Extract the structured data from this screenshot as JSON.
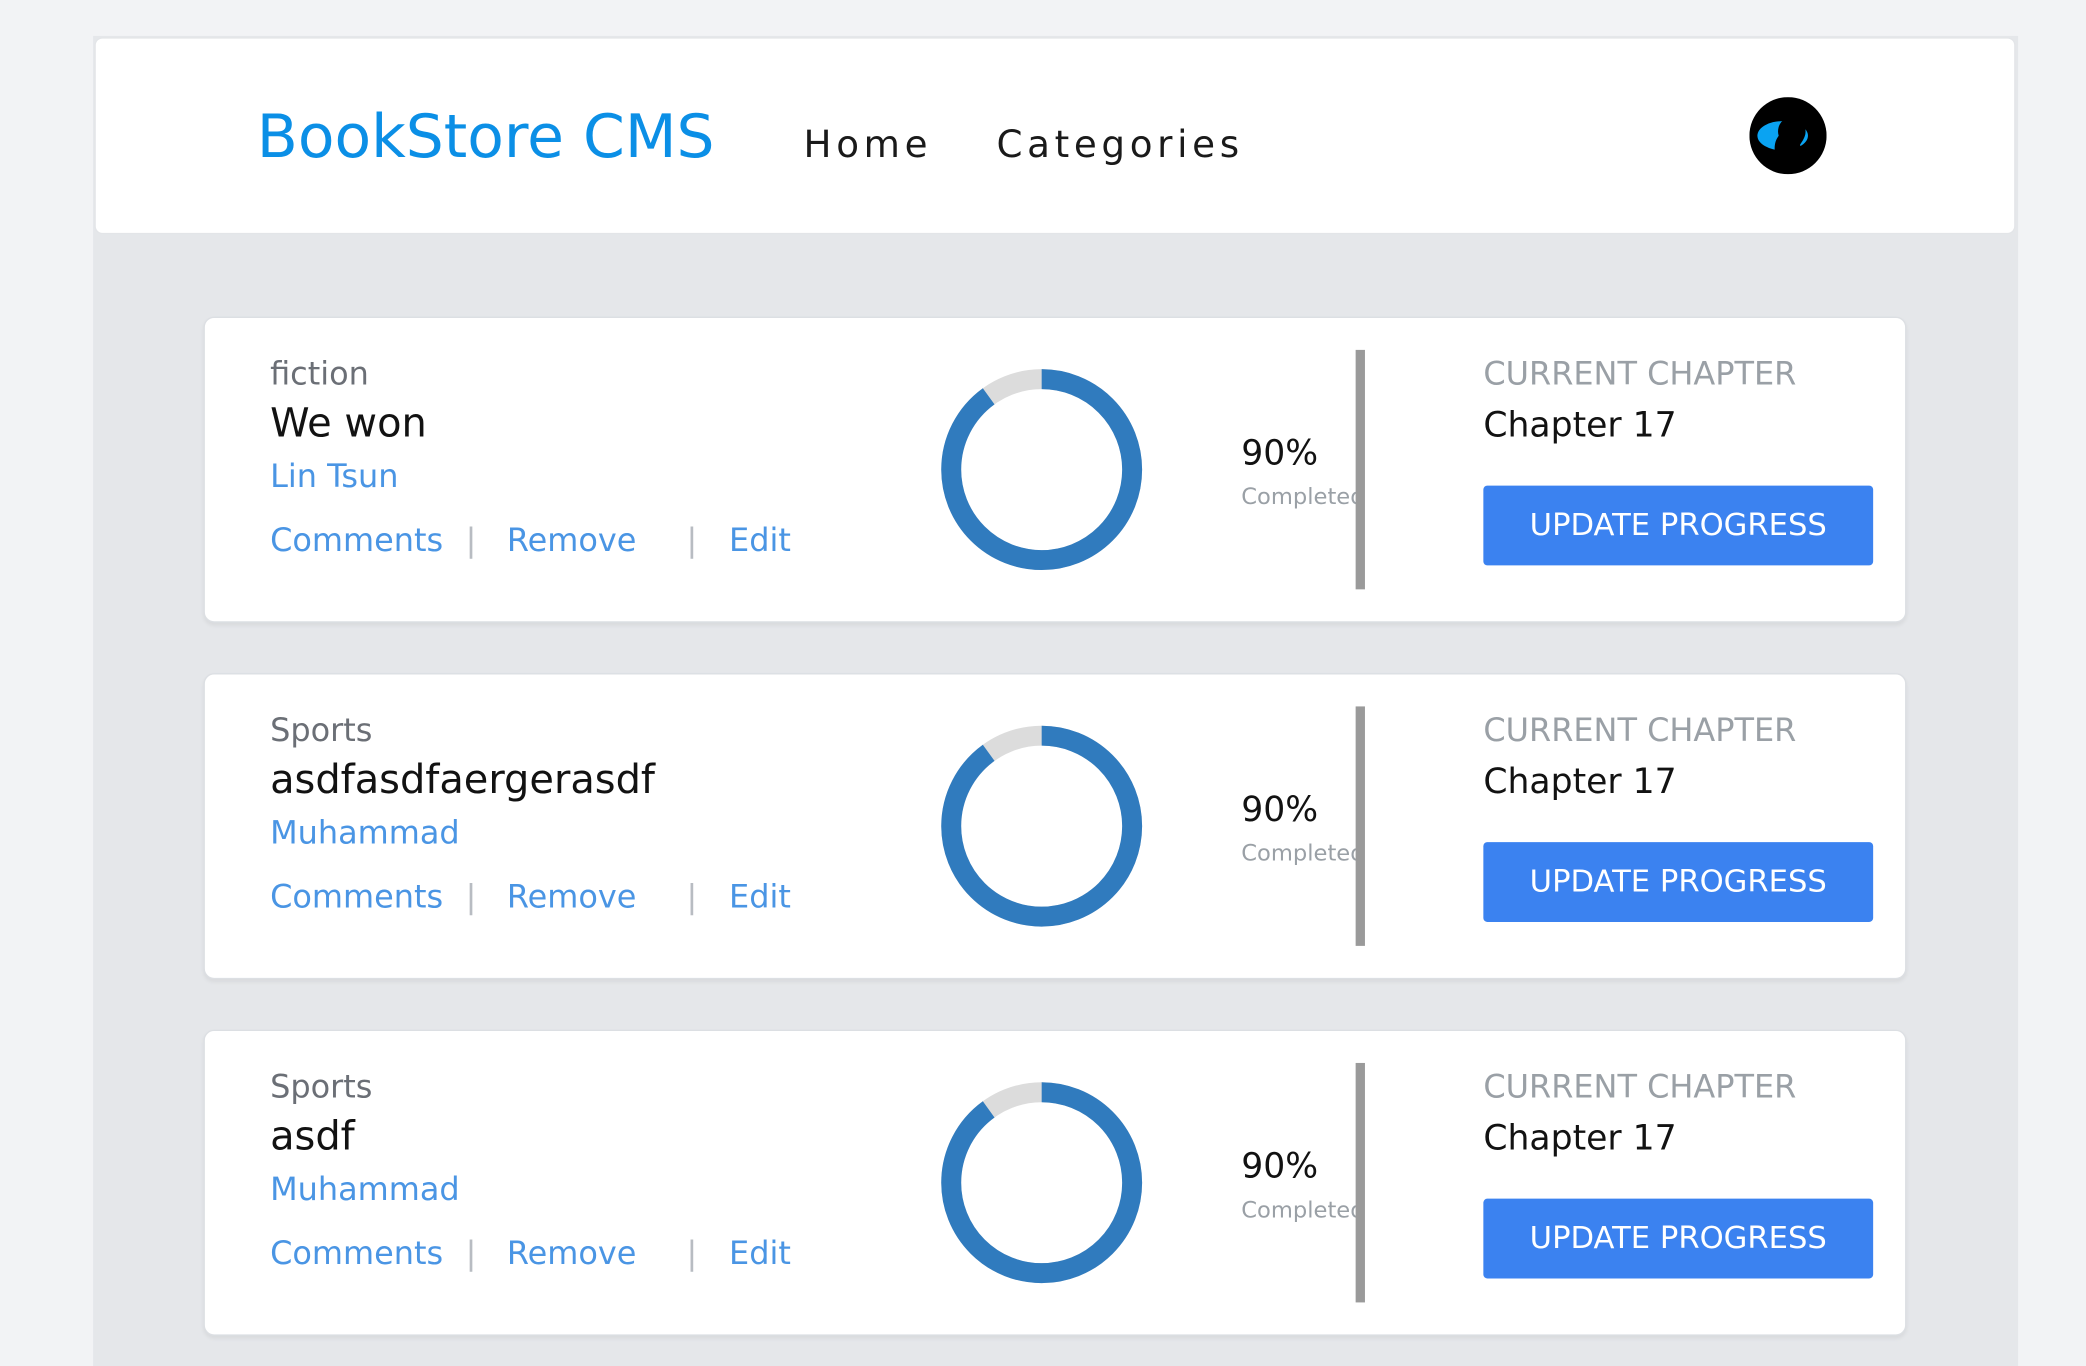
{
  "header": {
    "brand": "BookStore CMS",
    "nav": [
      {
        "label": "Home"
      },
      {
        "label": "Categories"
      }
    ],
    "avatar_icon": "user-silhouette-icon"
  },
  "books": [
    {
      "category": "fiction",
      "title": "We won",
      "author": "Lin Tsun",
      "actions": {
        "comments": "Comments",
        "remove": "Remove",
        "edit": "Edit"
      },
      "progress_percent": 90,
      "progress_text": "90%",
      "progress_label": "Completed",
      "current_chapter_label": "CURRENT CHAPTER",
      "current_chapter": "Chapter 17",
      "update_button": "UPDATE PROGRESS"
    },
    {
      "category": "Sports",
      "title": "asdfasdfaergerasdf",
      "author": "Muhammad",
      "actions": {
        "comments": "Comments",
        "remove": "Remove",
        "edit": "Edit"
      },
      "progress_percent": 90,
      "progress_text": "90%",
      "progress_label": "Completed",
      "current_chapter_label": "CURRENT CHAPTER",
      "current_chapter": "Chapter 17",
      "update_button": "UPDATE PROGRESS"
    },
    {
      "category": "Sports",
      "title": "asdf",
      "author": "Muhammad",
      "actions": {
        "comments": "Comments",
        "remove": "Remove",
        "edit": "Edit"
      },
      "progress_percent": 90,
      "progress_text": "90%",
      "progress_label": "Completed",
      "current_chapter_label": "CURRENT CHAPTER",
      "current_chapter": "Chapter 17",
      "update_button": "UPDATE PROGRESS"
    }
  ],
  "colors": {
    "brand": "#0b8fe6",
    "link": "#4a95e4",
    "button": "#3b82f0",
    "progress": "#307bbe",
    "progress_track": "#dcdcdc",
    "page_background": "#e5e7ea"
  }
}
